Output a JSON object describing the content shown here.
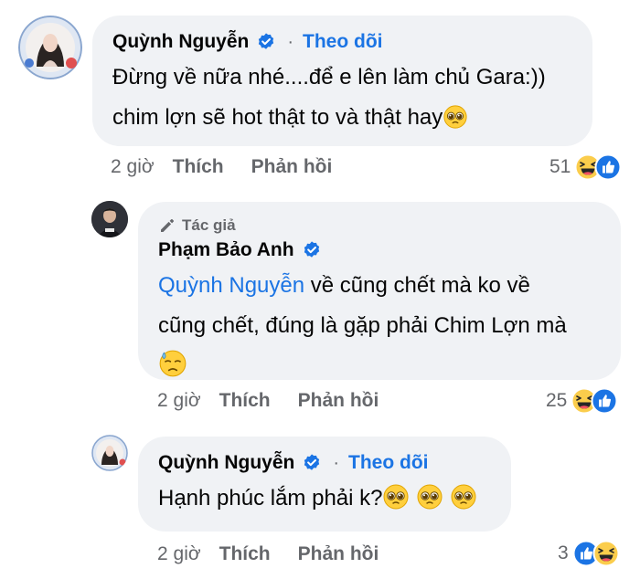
{
  "colors": {
    "bubble": "#f0f2f5",
    "link": "#1b74e4",
    "muted": "#65676b",
    "verified": "#1b74e4"
  },
  "comments": [
    {
      "author": "Quỳnh Nguyễn",
      "verified": true,
      "follow_label": "Theo dõi",
      "line1": "Đừng về nữa nhé....để e lên làm chủ Gara:))",
      "line2": "chim lợn sẽ hot thật to và thật hay",
      "time": "2 giờ",
      "like_label": "Thích",
      "reply_label": "Phản hồi",
      "reaction_count": "51",
      "reaction_icons": [
        "haha-icon",
        "like-icon"
      ]
    },
    {
      "author_tag": "Tác giả",
      "author": "Phạm Bảo Anh",
      "verified": true,
      "mention": "Quỳnh Nguyễn",
      "line1_rest": " về cũng chết mà ko về",
      "line2": "cũng chết, đúng là gặp phải Chim Lợn mà",
      "time": "2 giờ",
      "like_label": "Thích",
      "reply_label": "Phản hồi",
      "reaction_count": "25",
      "reaction_icons": [
        "haha-icon",
        "like-icon"
      ]
    },
    {
      "author": "Quỳnh Nguyễn",
      "verified": true,
      "follow_label": "Theo dõi",
      "text": "Hạnh phúc lắm phải k?",
      "time": "2 giờ",
      "like_label": "Thích",
      "reply_label": "Phản hồi",
      "reaction_count": "3",
      "reaction_icons": [
        "like-icon",
        "haha-icon"
      ]
    }
  ]
}
